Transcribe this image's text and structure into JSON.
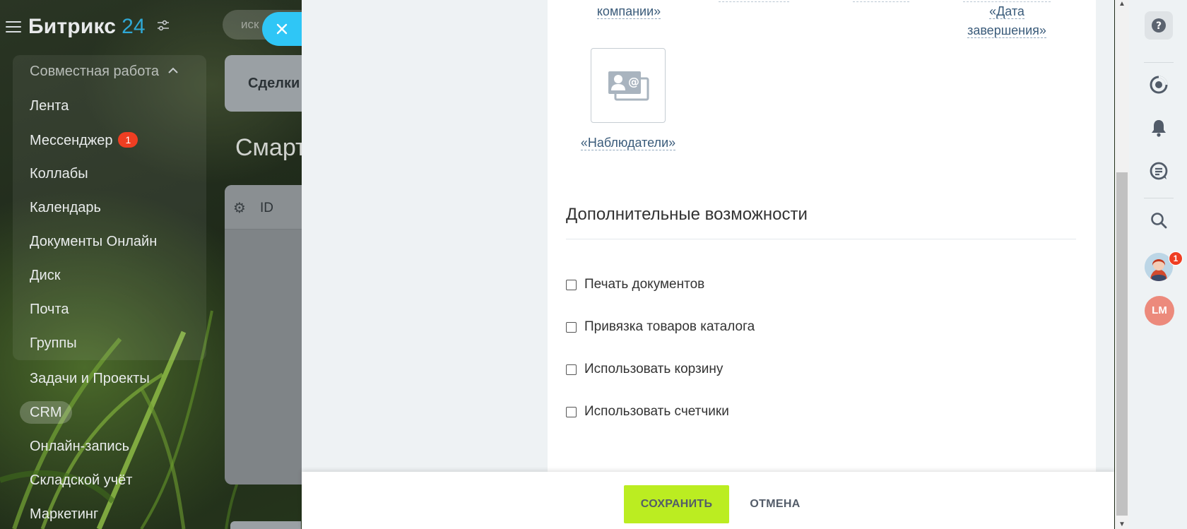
{
  "app": {
    "logo_text": "Битрикс",
    "logo_number": "24",
    "search_placeholder": "иск"
  },
  "sidebar": {
    "group_title": "Совместная работа",
    "items": [
      {
        "label": "Лента"
      },
      {
        "label": "Мессенджер",
        "badge": "1"
      },
      {
        "label": "Коллабы"
      },
      {
        "label": "Календарь"
      },
      {
        "label": "Документы Онлайн"
      },
      {
        "label": "Диск"
      },
      {
        "label": "Почта"
      },
      {
        "label": "Группы"
      },
      {
        "label": "Задачи и Проекты"
      },
      {
        "label": "CRM"
      },
      {
        "label": "Онлайн-запись"
      },
      {
        "label": "Складской учёт"
      },
      {
        "label": "Маркетинг"
      }
    ]
  },
  "background_page": {
    "card_tab": "Сделки",
    "title": "Смарт",
    "table_column_id": "ID"
  },
  "slider": {
    "field_company": "компании»",
    "field_end_date_line1": "«Дата",
    "field_end_date_line2": "завершения»",
    "field_observers": "«Наблюдатели»",
    "section_title": "Дополнительные возможности",
    "options": [
      {
        "label": "Печать документов",
        "checked": false
      },
      {
        "label": "Привязка товаров каталога",
        "checked": false
      },
      {
        "label": "Использовать корзину",
        "checked": false
      },
      {
        "label": "Использовать счетчики",
        "checked": false
      }
    ],
    "save_label": "СОХРАНИТЬ",
    "cancel_label": "ОТМЕНА"
  },
  "right_rail": {
    "avatar_badge": "1",
    "user_initials": "LM"
  },
  "colors": {
    "accent_close": "#2fc6f6",
    "save_button": "#bbed21",
    "badge": "#ef3e22",
    "link": "#3a5b7a"
  }
}
